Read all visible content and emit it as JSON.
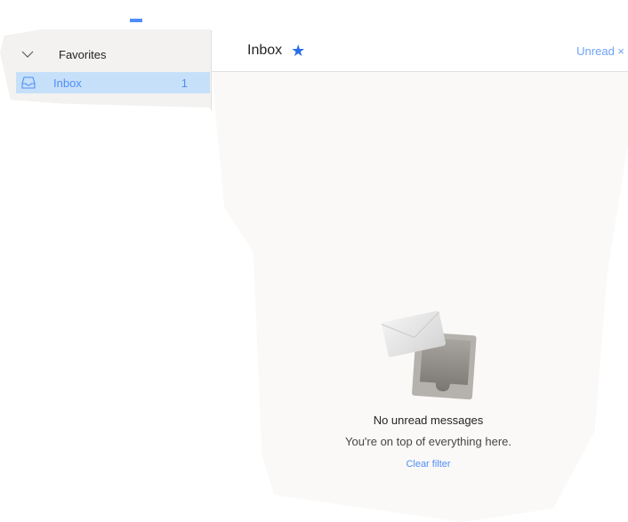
{
  "sidebar": {
    "favorites_label": "Favorites",
    "inbox": {
      "label": "Inbox",
      "count": "1"
    }
  },
  "header": {
    "title": "Inbox",
    "filter_label": "Unread ×"
  },
  "empty_state": {
    "title": "No unread messages",
    "subtitle": "You're on top of everything here.",
    "action": "Clear filter"
  },
  "colors": {
    "accent": "#4f8ef7",
    "selected": "#c7e0f9",
    "sidebar_bg": "#f3f2f1",
    "main_bg": "#faf9f8"
  }
}
